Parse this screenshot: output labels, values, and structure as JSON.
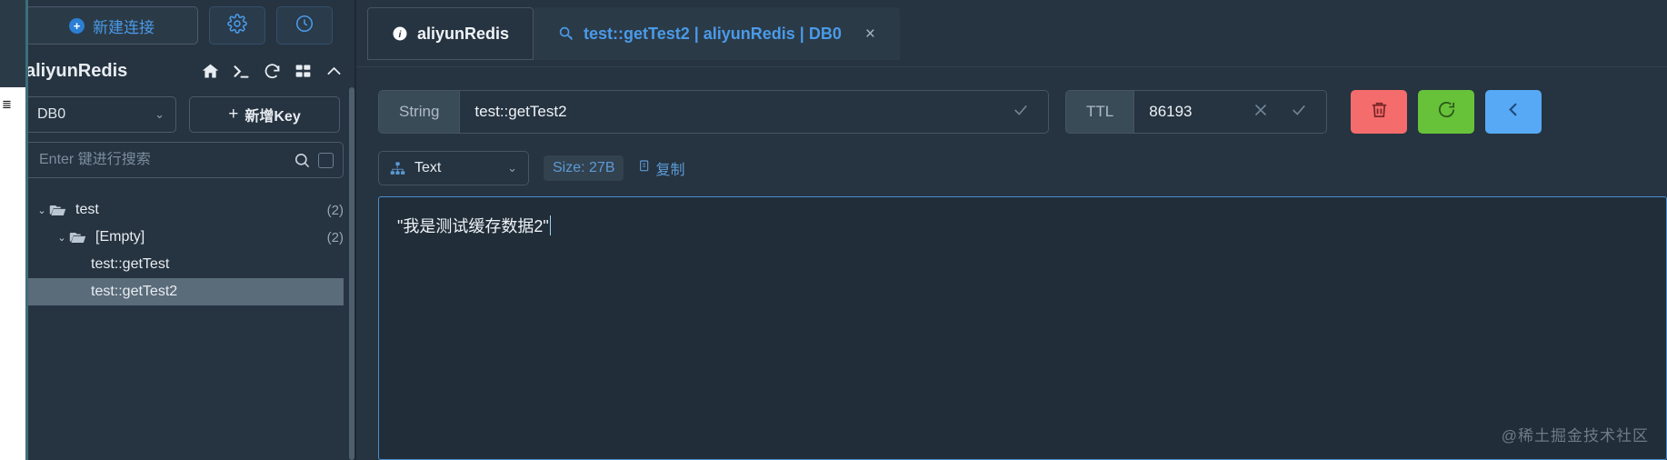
{
  "app": {
    "background": "#263340",
    "accent": "#4a9ae8"
  },
  "sidebar": {
    "toolbar": {
      "new_connection_label": "新建连接",
      "settings_icon": "gear-icon",
      "history_icon": "clock-icon"
    },
    "connection": {
      "name": "aliyunRedis",
      "icons": [
        "home-icon",
        "terminal-icon",
        "refresh-icon",
        "grid-icon",
        "collapse-icon"
      ]
    },
    "db": {
      "selected": "DB0",
      "add_key_label": "新增Key",
      "add_key_plus": "+"
    },
    "search": {
      "value": "",
      "placeholder": "Enter 键进行搜索",
      "icon": "search-icon",
      "checkbox_checked": false
    },
    "tree": [
      {
        "label": "test",
        "count": "(2)",
        "depth": 0,
        "type": "folder",
        "expanded": true,
        "selected": false
      },
      {
        "label": "[Empty]",
        "count": "(2)",
        "depth": 1,
        "type": "folder",
        "expanded": true,
        "selected": false
      },
      {
        "label": "test::getTest",
        "count": "",
        "depth": 2,
        "type": "key",
        "expanded": false,
        "selected": false
      },
      {
        "label": "test::getTest2",
        "count": "",
        "depth": 2,
        "type": "key",
        "expanded": false,
        "selected": true
      }
    ]
  },
  "main": {
    "tabs": [
      {
        "label": "aliyunRedis",
        "icon": "info-icon",
        "active": false,
        "closable": false
      },
      {
        "label": "test::getTest2 | aliyunRedis | DB0",
        "icon": "key-search-icon",
        "active": true,
        "closable": true,
        "close_label": "×"
      }
    ],
    "key_row": {
      "type_label": "String",
      "key_value": "test::getTest2",
      "key_confirm_icon": "check-icon",
      "ttl_label": "TTL",
      "ttl_value": "86193",
      "ttl_clear_icon": "close-icon",
      "ttl_confirm_icon": "check-icon"
    },
    "actions": [
      {
        "name": "delete-key-button",
        "icon": "trash-icon",
        "color": "#f56c6c"
      },
      {
        "name": "refresh-key-button",
        "icon": "refresh-icon",
        "color": "#67c23a"
      },
      {
        "name": "more-actions-button",
        "icon": "chevron-left-icon",
        "color": "#57a9f5"
      }
    ],
    "viewer": {
      "format": "Text",
      "format_icon": "tree-structure-icon",
      "size_badge": "Size: 27B",
      "copy_label": "复制",
      "copy_icon": "copy-icon",
      "content": "\"我是测试缓存数据2\""
    }
  },
  "watermark": "@稀土掘金技术社区"
}
